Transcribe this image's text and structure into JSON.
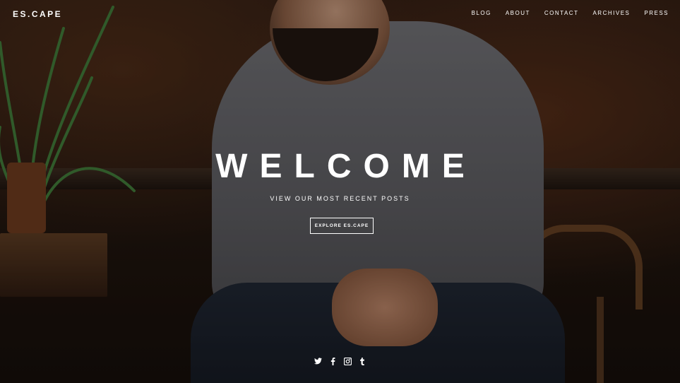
{
  "header": {
    "logo": "ES.CAPE",
    "nav": [
      "BLOG",
      "ABOUT",
      "CONTACT",
      "ARCHIVES",
      "PRESS"
    ]
  },
  "hero": {
    "title": "WELCOME",
    "subtitle": "VIEW OUR MOST RECENT POSTS",
    "button_label": "EXPLORE ES.CAPE"
  },
  "social": {
    "icons": [
      "twitter-icon",
      "facebook-icon",
      "instagram-icon",
      "tumblr-icon"
    ]
  },
  "colors": {
    "text": "#ffffff",
    "background": "#1a120d"
  }
}
